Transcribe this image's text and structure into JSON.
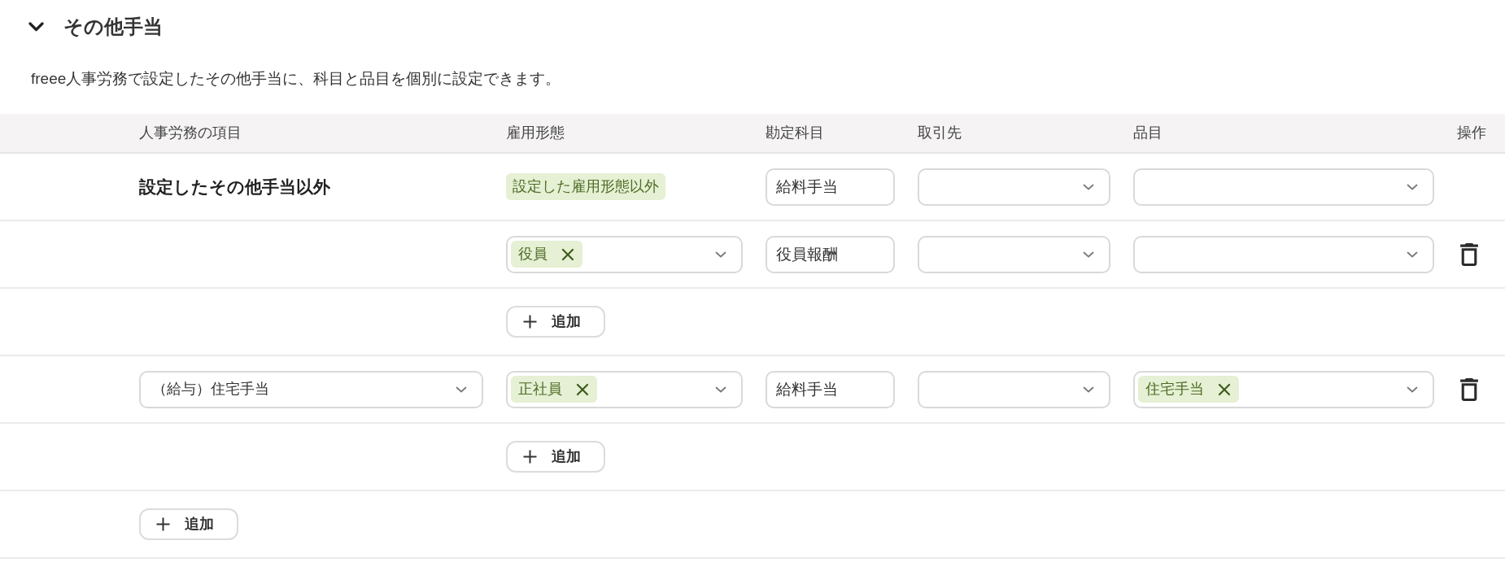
{
  "section": {
    "title": "その他手当",
    "expanded": true,
    "description": "freee人事労務で設定したその他手当に、科目と品目を個別に設定できます。"
  },
  "table": {
    "columns": [
      "人事労務の項目",
      "雇用形態",
      "勘定科目",
      "取引先",
      "品目",
      "操作"
    ],
    "groups": [
      {
        "item": {
          "kind": "label",
          "text": "設定したその他手当以外"
        },
        "rules": [
          {
            "employment": {
              "kind": "badge",
              "text": "設定した雇用形態以外"
            },
            "account": "給料手当",
            "partner": {
              "kind": "select"
            },
            "product": {
              "kind": "select"
            },
            "deletable": false
          },
          {
            "employment": {
              "kind": "select",
              "tags": [
                "役員"
              ]
            },
            "account": "役員報酬",
            "partner": {
              "kind": "select"
            },
            "product": {
              "kind": "select"
            },
            "deletable": true
          }
        ],
        "add_rule_button": "追加"
      },
      {
        "item": {
          "kind": "select",
          "value": "（給与）住宅手当"
        },
        "rules": [
          {
            "employment": {
              "kind": "select",
              "tags": [
                "正社員"
              ]
            },
            "account": "給料手当",
            "partner": {
              "kind": "select"
            },
            "product": {
              "kind": "select",
              "tags": [
                "住宅手当"
              ]
            },
            "deletable": true
          }
        ],
        "add_rule_button": "追加"
      }
    ],
    "add_item_button": "追加"
  }
}
